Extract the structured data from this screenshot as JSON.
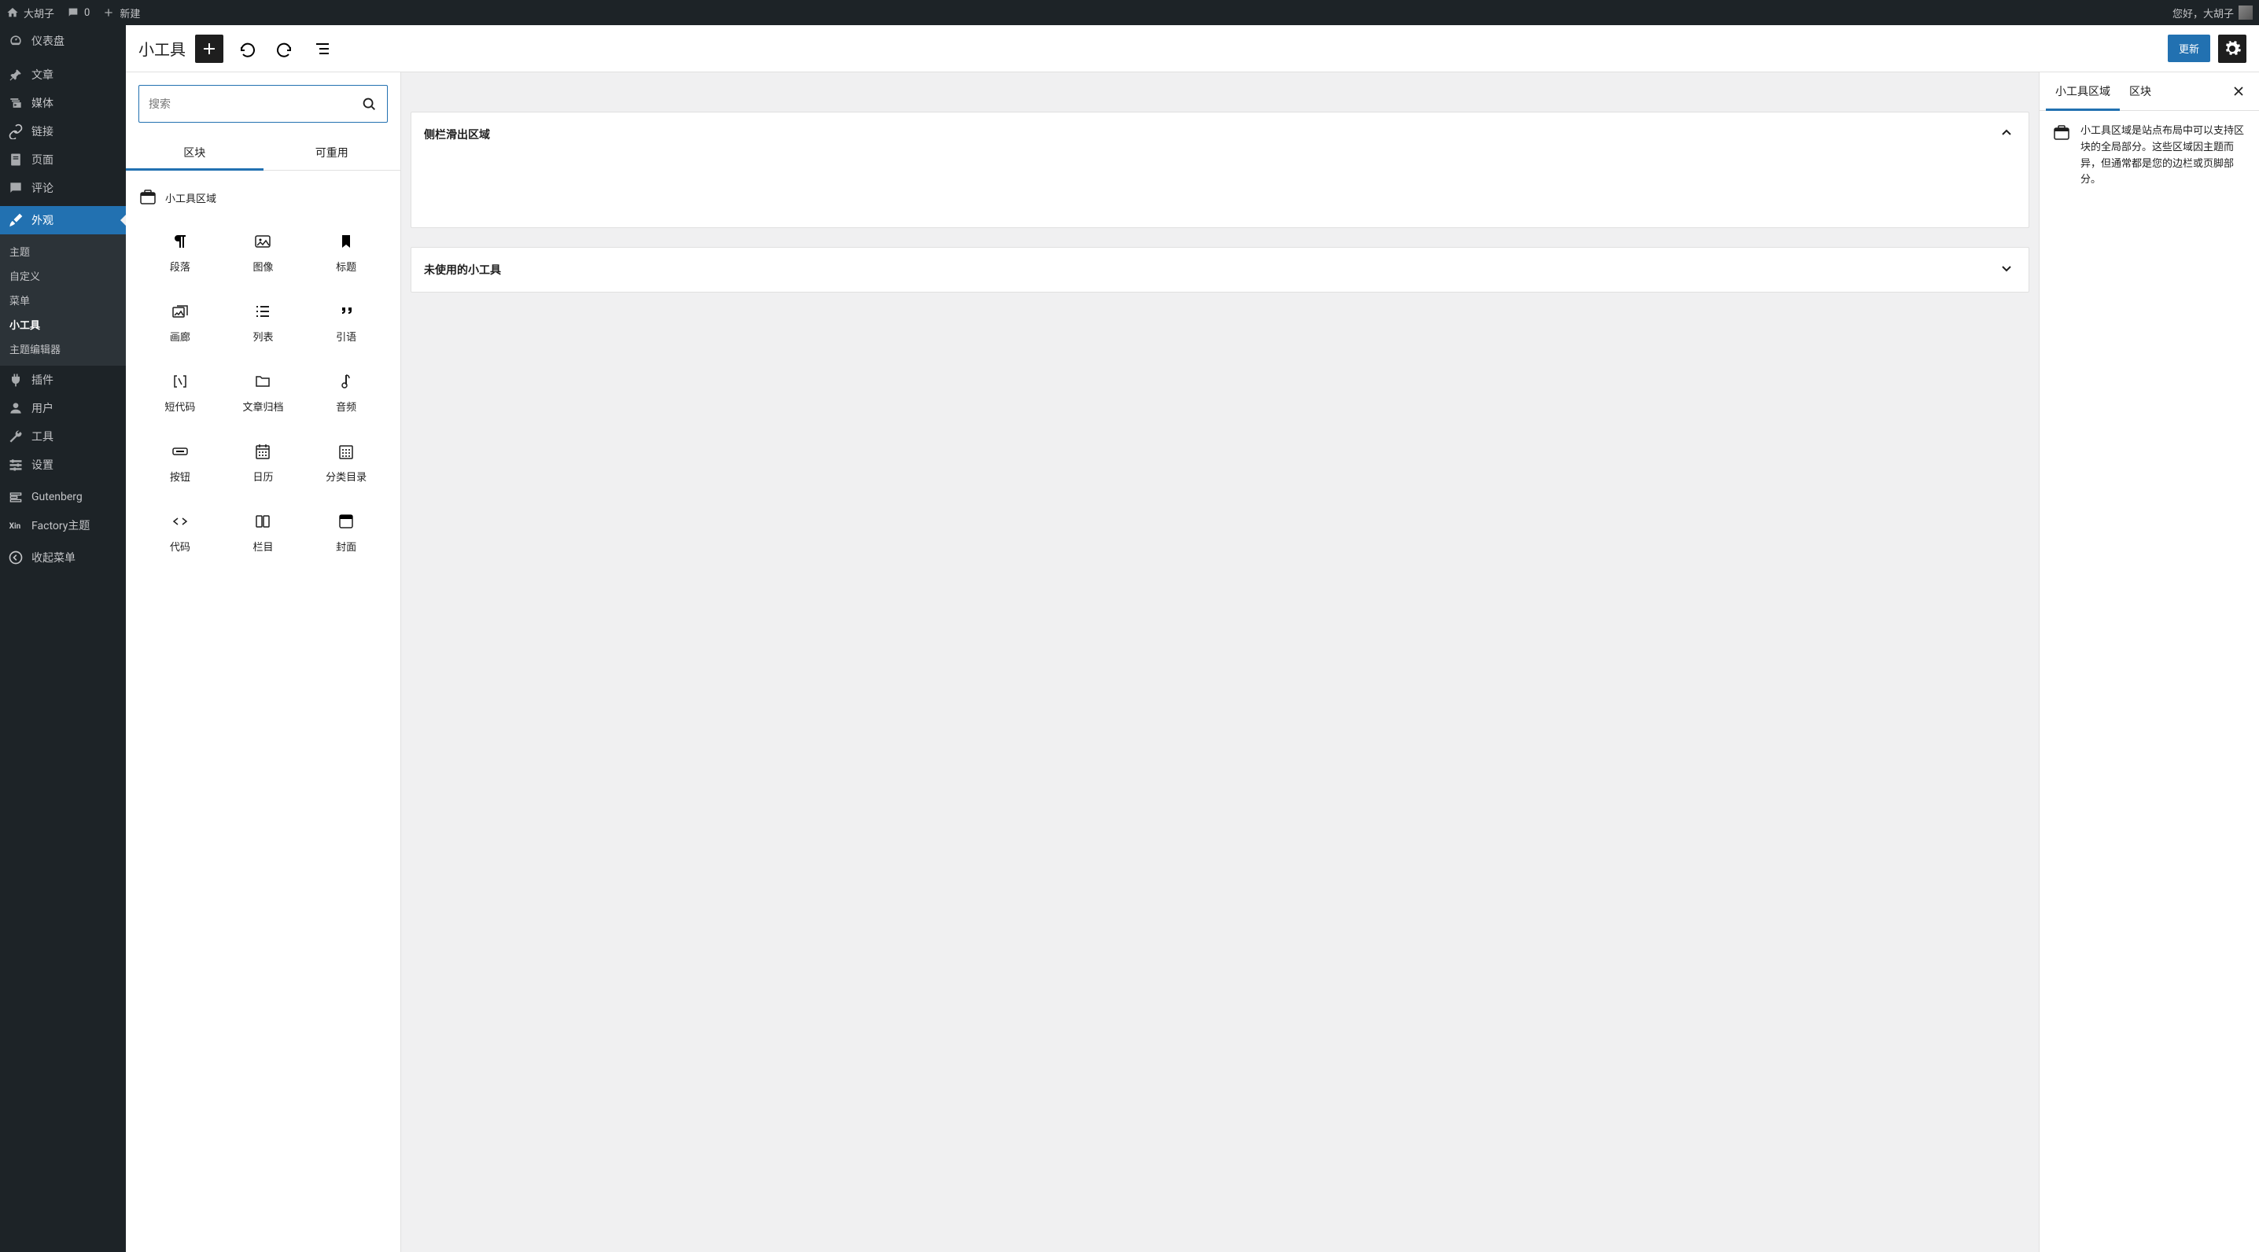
{
  "admin_bar": {
    "site_name": "大胡子",
    "comments_count": "0",
    "new_label": "新建",
    "greeting": "您好，大胡子"
  },
  "sidebar": {
    "dashboard": "仪表盘",
    "posts": "文章",
    "media": "媒体",
    "links": "链接",
    "pages": "页面",
    "comments": "评论",
    "appearance": "外观",
    "sub_themes": "主题",
    "sub_customize": "自定义",
    "sub_menus": "菜单",
    "sub_widgets": "小工具",
    "sub_theme_editor": "主题编辑器",
    "plugins": "插件",
    "users": "用户",
    "tools": "工具",
    "settings": "设置",
    "gutenberg": "Gutenberg",
    "factory_theme": "Factory主题",
    "collapse": "收起菜单"
  },
  "editor": {
    "title": "小工具",
    "update_label": "更新",
    "search_placeholder": "搜索",
    "tab_blocks": "区块",
    "tab_reusable": "可重用",
    "category_label": "小工具区域",
    "blocks": [
      {
        "label": "段落",
        "icon": "pilcrow"
      },
      {
        "label": "图像",
        "icon": "image"
      },
      {
        "label": "标题",
        "icon": "bookmark"
      },
      {
        "label": "画廊",
        "icon": "gallery"
      },
      {
        "label": "列表",
        "icon": "list"
      },
      {
        "label": "引语",
        "icon": "quote"
      },
      {
        "label": "短代码",
        "icon": "shortcode"
      },
      {
        "label": "文章归档",
        "icon": "folder"
      },
      {
        "label": "音频",
        "icon": "audio"
      },
      {
        "label": "按钮",
        "icon": "button"
      },
      {
        "label": "日历",
        "icon": "calendar"
      },
      {
        "label": "分类目录",
        "icon": "categories"
      },
      {
        "label": "代码",
        "icon": "code"
      },
      {
        "label": "栏目",
        "icon": "columns"
      },
      {
        "label": "封面",
        "icon": "cover"
      }
    ]
  },
  "canvas": {
    "area1_title": "侧栏滑出区域",
    "area2_title": "未使用的小工具"
  },
  "settings_panel": {
    "tab_areas": "小工具区域",
    "tab_block": "区块",
    "description": "小工具区域是站点布局中可以支持区块的全局部分。这些区域因主题而异，但通常都是您的边栏或页脚部分。"
  }
}
